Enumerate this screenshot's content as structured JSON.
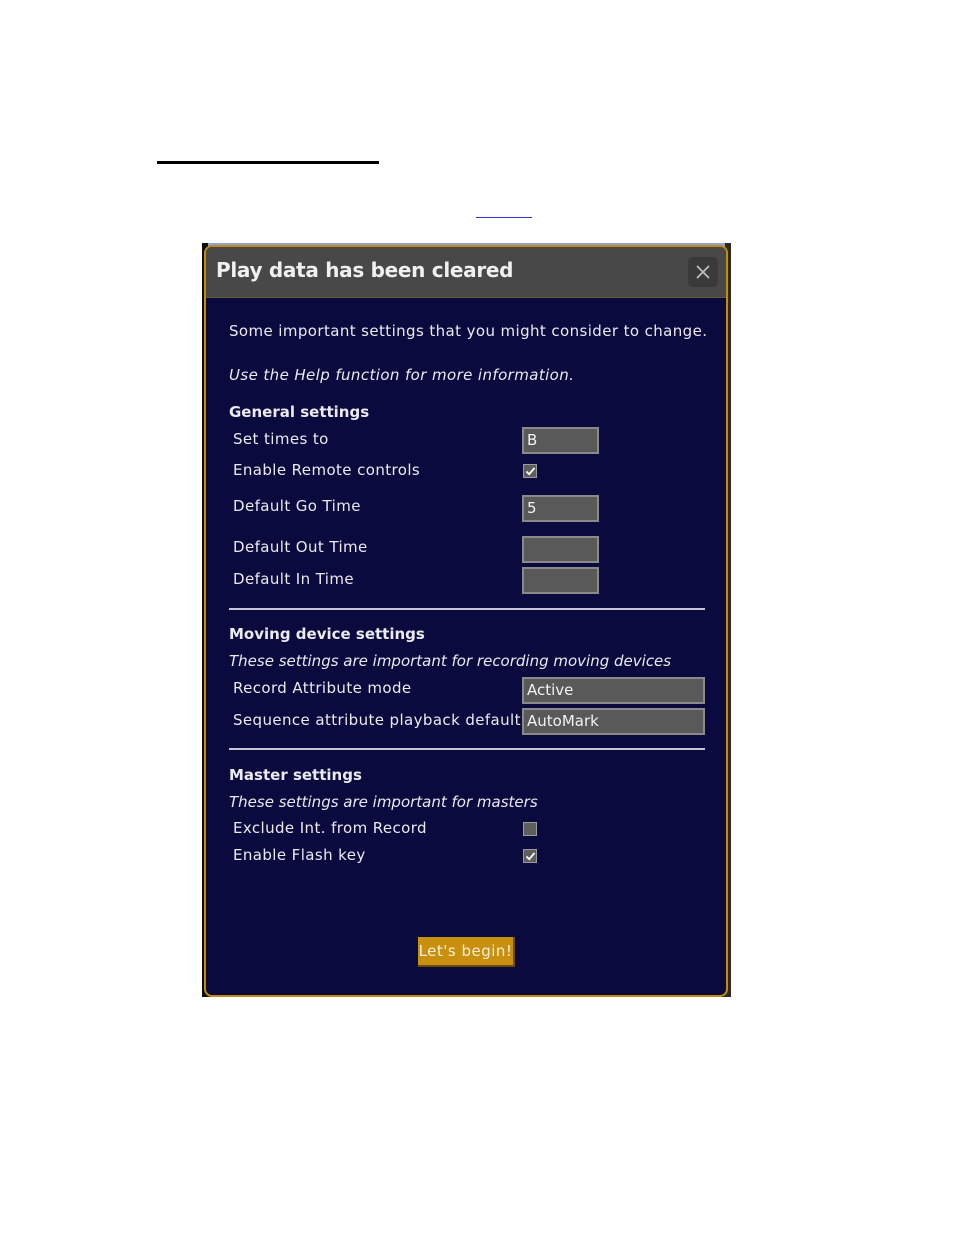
{
  "dialog": {
    "title": "Play data has been cleared",
    "close_icon": "close-icon",
    "intro": "Some important settings that you might consider to change.",
    "help_note": "Use the Help function for more information.",
    "sections": {
      "general": {
        "title": "General settings",
        "rows": {
          "set_times_to": {
            "label": "Set times to",
            "value": "B"
          },
          "enable_remote_controls": {
            "label": "Enable Remote controls",
            "checked": true
          },
          "default_go_time": {
            "label": "Default Go Time",
            "value": "5"
          },
          "default_out_time": {
            "label": "Default Out Time",
            "value": ""
          },
          "default_in_time": {
            "label": "Default In Time",
            "value": ""
          }
        }
      },
      "moving_device": {
        "title": "Moving device settings",
        "subtitle": "These settings are important for recording moving devices",
        "rows": {
          "record_attribute_mode": {
            "label": "Record Attribute mode",
            "value": "Active"
          },
          "sequence_attribute_playback_default": {
            "label": "Sequence attribute playback default",
            "value": "AutoMark"
          }
        }
      },
      "master": {
        "title": "Master settings",
        "subtitle": "These settings are important for masters",
        "rows": {
          "exclude_int_from_record": {
            "label": "Exclude Int. from Record",
            "checked": false
          },
          "enable_flash_key": {
            "label": "Enable Flash key",
            "checked": true
          }
        }
      }
    },
    "begin_button": "Let's begin!"
  },
  "colors": {
    "dialog_body": "#0b0a3f",
    "dialog_header": "#484848",
    "dialog_border": "#c58a12",
    "button_accent": "#c8900e",
    "field_bg": "#595959"
  }
}
